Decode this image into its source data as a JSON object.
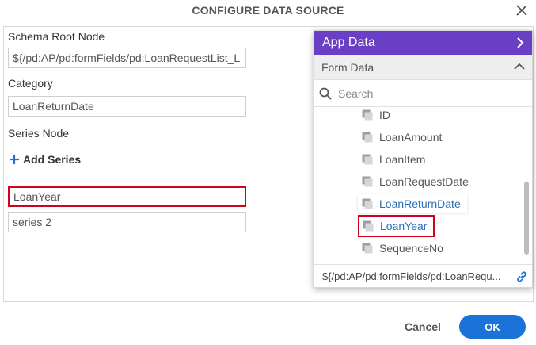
{
  "dialog": {
    "title": "CONFIGURE DATA SOURCE"
  },
  "form": {
    "schema_root_label": "Schema Root Node",
    "schema_root_value": "${/pd:AP/pd:formFields/pd:LoanRequestList_L",
    "category_label": "Category",
    "category_value": "LoanReturnDate",
    "series_node_label": "Series Node",
    "add_series_label": "Add Series",
    "series": [
      {
        "value": "LoanYear"
      },
      {
        "value": "series 2"
      }
    ]
  },
  "picker": {
    "header": "App Data",
    "subheader": "Form Data",
    "search_placeholder": "Search",
    "items": [
      {
        "label": "ID"
      },
      {
        "label": "LoanAmount"
      },
      {
        "label": "LoanItem"
      },
      {
        "label": "LoanRequestDate"
      },
      {
        "label": "LoanReturnDate"
      },
      {
        "label": "LoanYear"
      },
      {
        "label": "SequenceNo"
      }
    ],
    "footer_path": "${/pd:AP/pd:formFields/pd:LoanRequ..."
  },
  "buttons": {
    "cancel": "Cancel",
    "ok": "OK"
  },
  "colors": {
    "header_purple": "#6a3fc6",
    "primary_blue": "#1a73d9",
    "link_blue": "#2a6fb7",
    "highlight_red": "#d0021b"
  }
}
